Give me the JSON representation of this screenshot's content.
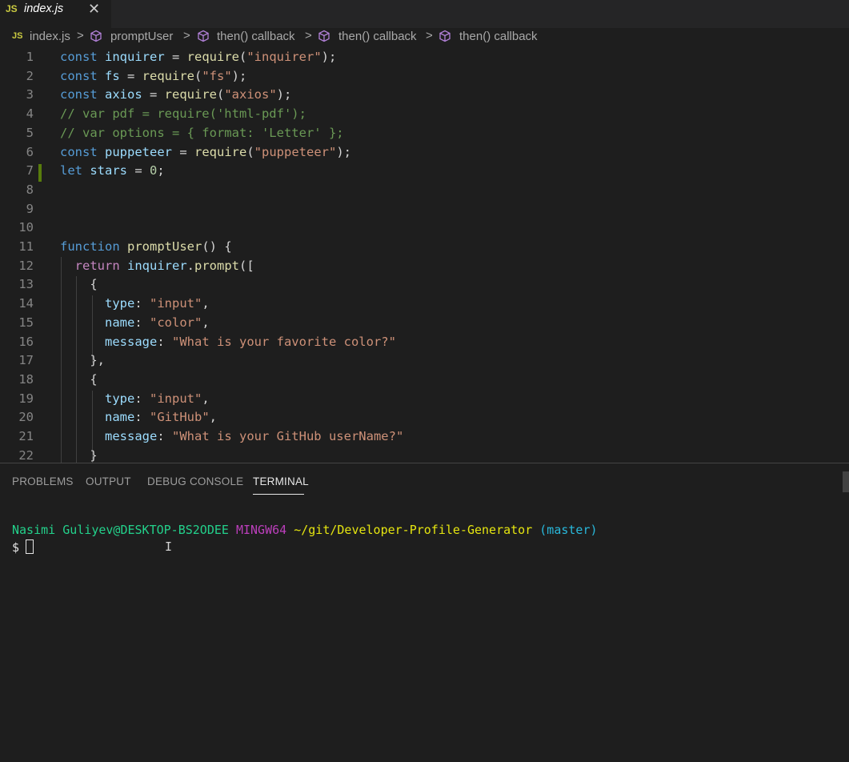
{
  "tab": {
    "lang_badge": "JS",
    "filename": "index.js",
    "close_glyph": "✕"
  },
  "breadcrumbs": {
    "file": "index.js",
    "items": [
      "promptUser",
      "then() callback",
      "then() callback",
      "then() callback"
    ],
    "separator": ">"
  },
  "editor": {
    "lines": [
      {
        "n": "1"
      },
      {
        "n": "2"
      },
      {
        "n": "3"
      },
      {
        "n": "4"
      },
      {
        "n": "5"
      },
      {
        "n": "6"
      },
      {
        "n": "7"
      },
      {
        "n": "8"
      },
      {
        "n": "9"
      },
      {
        "n": "10"
      },
      {
        "n": "11"
      },
      {
        "n": "12"
      },
      {
        "n": "13"
      },
      {
        "n": "14"
      },
      {
        "n": "15"
      },
      {
        "n": "16"
      },
      {
        "n": "17"
      },
      {
        "n": "18"
      },
      {
        "n": "19"
      },
      {
        "n": "20"
      },
      {
        "n": "21"
      },
      {
        "n": "22"
      }
    ],
    "code": [
      [
        [
          "kw",
          "const "
        ],
        [
          "var",
          "inquirer"
        ],
        [
          "p",
          " = "
        ],
        [
          "fn",
          "require"
        ],
        [
          "p",
          "("
        ],
        [
          "str",
          "\"inquirer\""
        ],
        [
          "p",
          ");"
        ]
      ],
      [
        [
          "kw",
          "const "
        ],
        [
          "var",
          "fs"
        ],
        [
          "p",
          " = "
        ],
        [
          "fn",
          "require"
        ],
        [
          "p",
          "("
        ],
        [
          "str",
          "\"fs\""
        ],
        [
          "p",
          ");"
        ]
      ],
      [
        [
          "kw",
          "const "
        ],
        [
          "var",
          "axios"
        ],
        [
          "p",
          " = "
        ],
        [
          "fn",
          "require"
        ],
        [
          "p",
          "("
        ],
        [
          "str",
          "\"axios\""
        ],
        [
          "p",
          ");"
        ]
      ],
      [
        [
          "cmt",
          "// var pdf = require('html-pdf');"
        ]
      ],
      [
        [
          "cmt",
          "// var options = { format: 'Letter' };"
        ]
      ],
      [
        [
          "kw",
          "const "
        ],
        [
          "var",
          "puppeteer"
        ],
        [
          "p",
          " = "
        ],
        [
          "fn",
          "require"
        ],
        [
          "p",
          "("
        ],
        [
          "str",
          "\"puppeteer\""
        ],
        [
          "p",
          ");"
        ]
      ],
      [
        [
          "kw",
          "let "
        ],
        [
          "var",
          "stars"
        ],
        [
          "p",
          " = "
        ],
        [
          "num",
          "0"
        ],
        [
          "p",
          ";"
        ]
      ],
      [],
      [],
      [],
      [
        [
          "kw",
          "function "
        ],
        [
          "fn",
          "promptUser"
        ],
        [
          "p",
          "() {"
        ]
      ],
      [
        [
          "p",
          "  "
        ],
        [
          "ctl",
          "return "
        ],
        [
          "var",
          "inquirer"
        ],
        [
          "p",
          "."
        ],
        [
          "fn",
          "prompt"
        ],
        [
          "p",
          "(["
        ]
      ],
      [
        [
          "p",
          "    {"
        ]
      ],
      [
        [
          "p",
          "      "
        ],
        [
          "var",
          "type"
        ],
        [
          "p",
          ": "
        ],
        [
          "str",
          "\"input\""
        ],
        [
          "p",
          ","
        ]
      ],
      [
        [
          "p",
          "      "
        ],
        [
          "var",
          "name"
        ],
        [
          "p",
          ": "
        ],
        [
          "str",
          "\"color\""
        ],
        [
          "p",
          ","
        ]
      ],
      [
        [
          "p",
          "      "
        ],
        [
          "var",
          "message"
        ],
        [
          "p",
          ": "
        ],
        [
          "str",
          "\"What is your favorite color?\""
        ]
      ],
      [
        [
          "p",
          "    },"
        ]
      ],
      [
        [
          "p",
          "    {"
        ]
      ],
      [
        [
          "p",
          "      "
        ],
        [
          "var",
          "type"
        ],
        [
          "p",
          ": "
        ],
        [
          "str",
          "\"input\""
        ],
        [
          "p",
          ","
        ]
      ],
      [
        [
          "p",
          "      "
        ],
        [
          "var",
          "name"
        ],
        [
          "p",
          ": "
        ],
        [
          "str",
          "\"GitHub\""
        ],
        [
          "p",
          ","
        ]
      ],
      [
        [
          "p",
          "      "
        ],
        [
          "var",
          "message"
        ],
        [
          "p",
          ": "
        ],
        [
          "str",
          "\"What is your GitHub userName?\""
        ]
      ],
      [
        [
          "p",
          "    }"
        ]
      ]
    ]
  },
  "panel": {
    "tabs": [
      "PROBLEMS",
      "OUTPUT",
      "DEBUG CONSOLE",
      "TERMINAL"
    ],
    "active_tab": "TERMINAL"
  },
  "terminal": {
    "user_host": "Nasimi Guliyev@DESKTOP-BS2ODEE",
    "shell": "MINGW64",
    "path": "~/git/Developer-Profile-Generator",
    "branch": "(master)",
    "prompt": "$"
  },
  "colors": {
    "editor_bg": "#1e1e1e",
    "keyword": "#569cd6",
    "string": "#ce9178",
    "comment": "#6a9955",
    "function": "#dcdcaa",
    "variable": "#9cdcfe"
  }
}
